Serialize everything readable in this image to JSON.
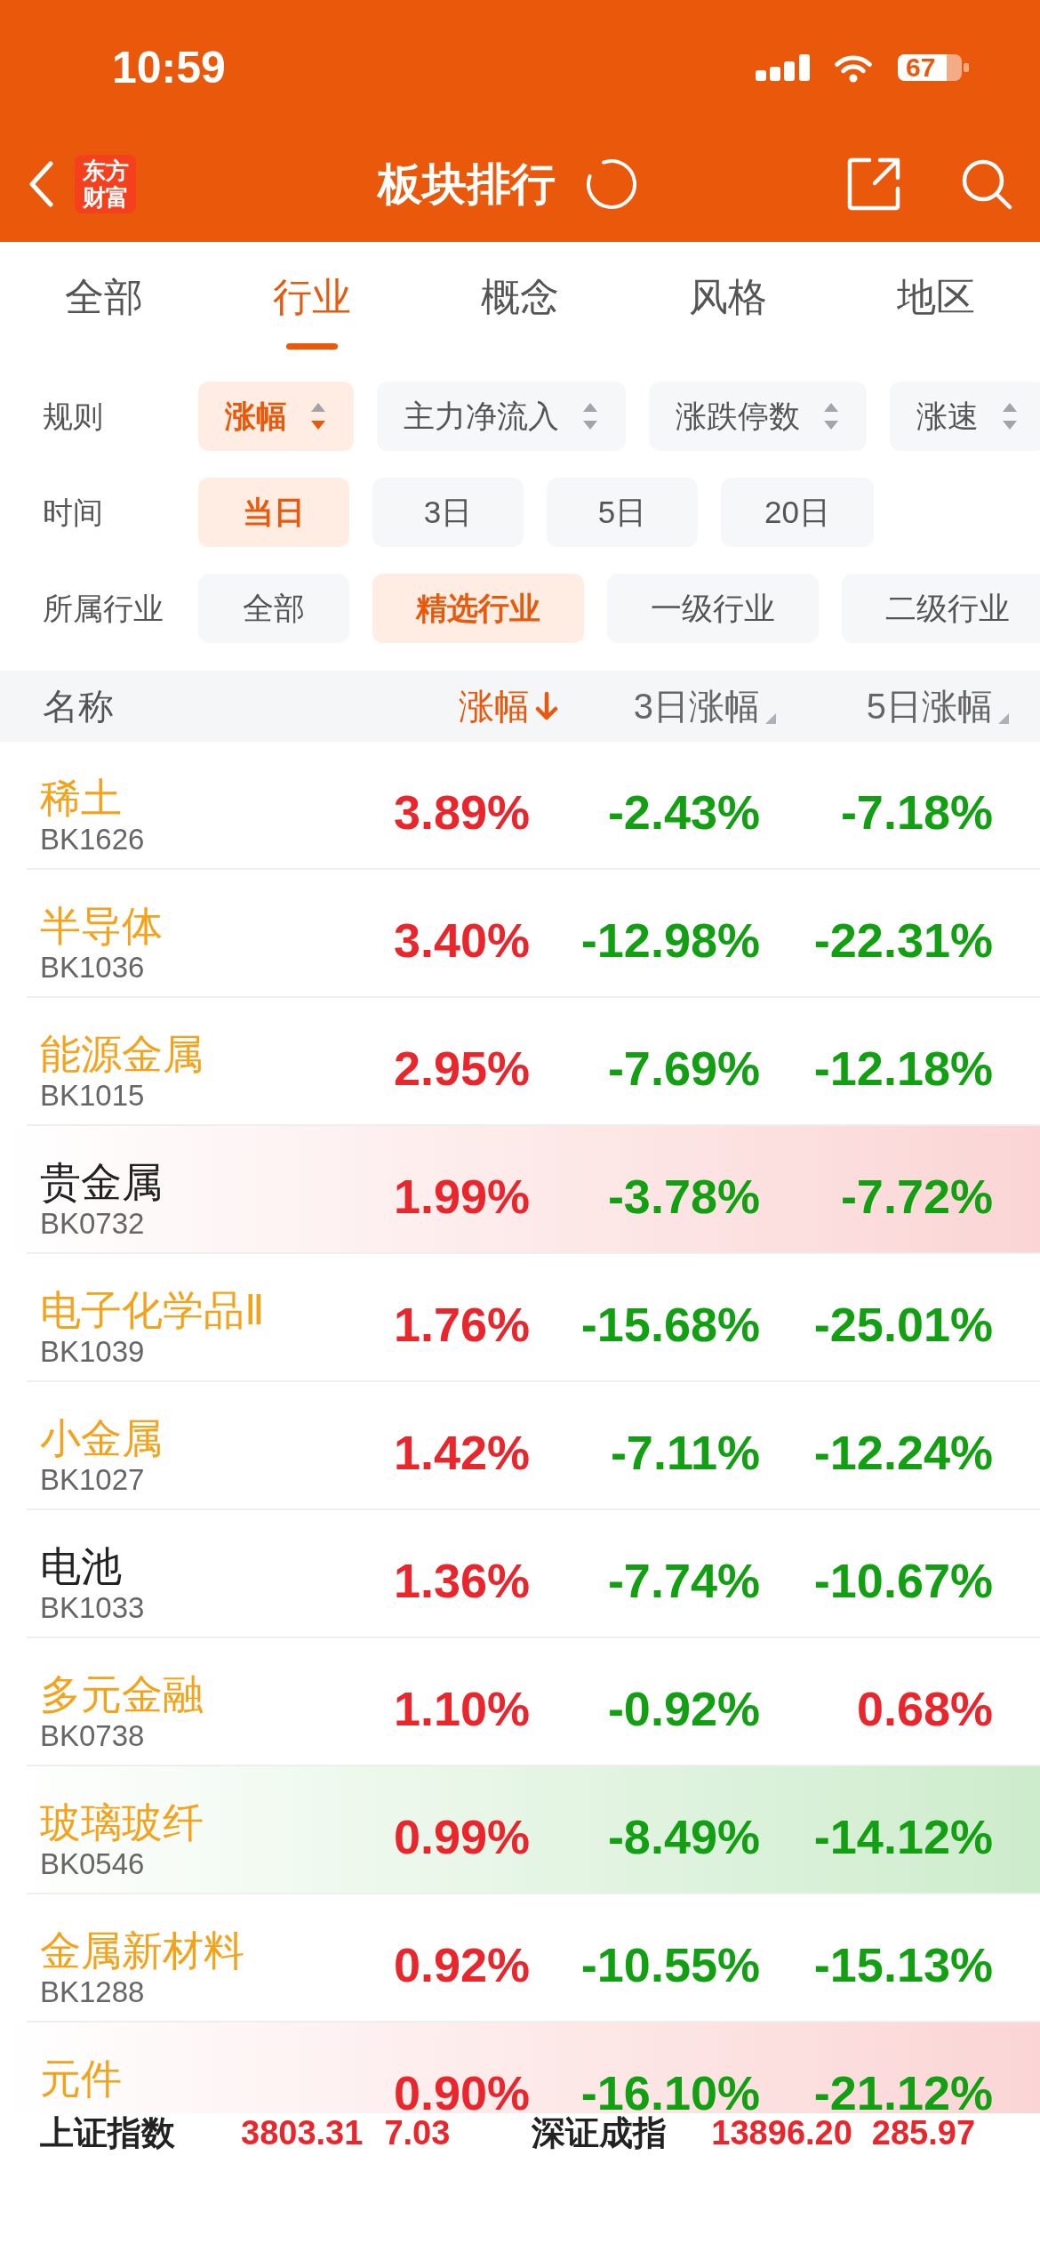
{
  "status_bar": {
    "time": "10:59",
    "battery": "67"
  },
  "nav": {
    "logo": "东方财富",
    "title": "板块排行"
  },
  "tabs": [
    {
      "label": "全部",
      "selected": false
    },
    {
      "label": "行业",
      "selected": true
    },
    {
      "label": "概念",
      "selected": false
    },
    {
      "label": "风格",
      "selected": false
    },
    {
      "label": "地区",
      "selected": false
    }
  ],
  "filters": [
    {
      "label": "规则",
      "kind": "sort",
      "options": [
        {
          "label": "涨幅",
          "selected": true
        },
        {
          "label": "主力净流入",
          "selected": false
        },
        {
          "label": "涨跌停数",
          "selected": false
        },
        {
          "label": "涨速",
          "selected": false
        }
      ]
    },
    {
      "label": "时间",
      "kind": "plain",
      "options": [
        {
          "label": "当日",
          "selected": true
        },
        {
          "label": "3日",
          "selected": false
        },
        {
          "label": "5日",
          "selected": false
        },
        {
          "label": "20日",
          "selected": false
        }
      ]
    },
    {
      "label": "所属行业",
      "kind": "plain",
      "options": [
        {
          "label": "全部",
          "selected": false
        },
        {
          "label": "精选行业",
          "selected": true
        },
        {
          "label": "一级行业",
          "selected": false
        },
        {
          "label": "二级行业",
          "selected": false
        }
      ]
    }
  ],
  "table": {
    "columns": [
      {
        "label": "名称"
      },
      {
        "label": "涨幅",
        "sorted": true
      },
      {
        "label": "3日涨幅",
        "sorted": false
      },
      {
        "label": "5日涨幅",
        "sorted": false
      }
    ],
    "rows": [
      {
        "kind": "plain",
        "name": "稀土",
        "code": "BK1626",
        "color": "#f5a21b",
        "changes": [
          {
            "text": "3.89%",
            "positive": true
          },
          {
            "text": "-2.43%",
            "positive": false
          },
          {
            "text": "-7.18%",
            "positive": false
          }
        ]
      },
      {
        "kind": "plain",
        "name": "半导体",
        "code": "BK1036",
        "color": "#f5a21b",
        "changes": [
          {
            "text": "3.40%",
            "positive": true
          },
          {
            "text": "-12.98%",
            "positive": false
          },
          {
            "text": "-22.31%",
            "positive": false
          }
        ]
      },
      {
        "kind": "plain",
        "name": "能源金属",
        "code": "BK1015",
        "color": "#f5a21b",
        "changes": [
          {
            "text": "2.95%",
            "positive": true
          },
          {
            "text": "-7.69%",
            "positive": false
          },
          {
            "text": "-12.18%",
            "positive": false
          }
        ]
      },
      {
        "kind": "rising",
        "name": "贵金属",
        "code": "BK0732",
        "color": "#222222",
        "changes": [
          {
            "text": "1.99%",
            "positive": true
          },
          {
            "text": "-3.78%",
            "positive": false
          },
          {
            "text": "-7.72%",
            "positive": false
          }
        ]
      },
      {
        "kind": "plain",
        "name": "电子化学品Ⅱ",
        "code": "BK1039",
        "color": "#f5a21b",
        "changes": [
          {
            "text": "1.76%",
            "positive": true
          },
          {
            "text": "-15.68%",
            "positive": false
          },
          {
            "text": "-25.01%",
            "positive": false
          }
        ]
      },
      {
        "kind": "plain",
        "name": "小金属",
        "code": "BK1027",
        "color": "#f5a21b",
        "changes": [
          {
            "text": "1.42%",
            "positive": true
          },
          {
            "text": "-7.11%",
            "positive": false
          },
          {
            "text": "-12.24%",
            "positive": false
          }
        ]
      },
      {
        "kind": "plain",
        "name": "电池",
        "code": "BK1033",
        "color": "#222222",
        "changes": [
          {
            "text": "1.36%",
            "positive": true
          },
          {
            "text": "-7.74%",
            "positive": false
          },
          {
            "text": "-10.67%",
            "positive": false
          }
        ]
      },
      {
        "kind": "plain",
        "name": "多元金融",
        "code": "BK0738",
        "color": "#f5a21b",
        "changes": [
          {
            "text": "1.10%",
            "positive": true
          },
          {
            "text": "-0.92%",
            "positive": false
          },
          {
            "text": "0.68%",
            "positive": true
          }
        ]
      },
      {
        "kind": "falling",
        "name": "玻璃玻纤",
        "code": "BK0546",
        "color": "#f5a21b",
        "changes": [
          {
            "text": "0.99%",
            "positive": true
          },
          {
            "text": "-8.49%",
            "positive": false
          },
          {
            "text": "-14.12%",
            "positive": false
          }
        ]
      },
      {
        "kind": "plain",
        "name": "金属新材料",
        "code": "BK1288",
        "color": "#f5a21b",
        "changes": [
          {
            "text": "0.92%",
            "positive": true
          },
          {
            "text": "-10.55%",
            "positive": false
          },
          {
            "text": "-15.13%",
            "positive": false
          }
        ]
      },
      {
        "kind": "rising",
        "name": "元件",
        "color": "#f5a21b",
        "changes": [
          {
            "text": "0.90%",
            "positive": true
          },
          {
            "text": "-16.10%",
            "positive": false
          },
          {
            "text": "-21.12%",
            "positive": false
          }
        ]
      }
    ]
  },
  "index_bar": [
    {
      "name": "上证指数",
      "value": "3803.31",
      "change": "7.03",
      "positive": true
    },
    {
      "name": "深证成指",
      "value": "13896.20",
      "change": "285.97",
      "positive": true
    }
  ]
}
